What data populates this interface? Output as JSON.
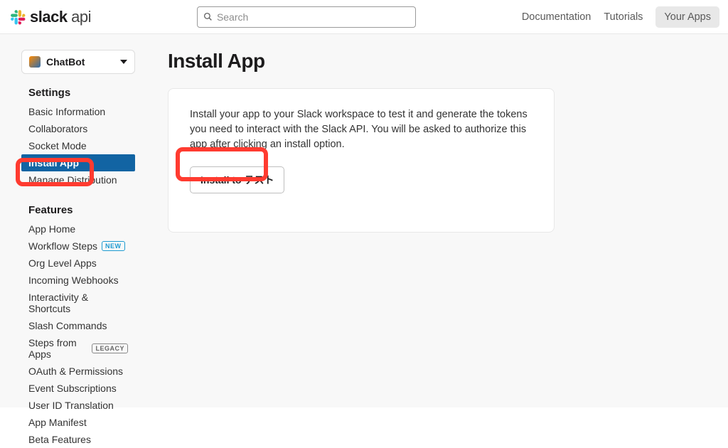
{
  "header": {
    "brand_bold": "slack",
    "brand_light": " api",
    "search_placeholder": "Search",
    "nav": {
      "documentation": "Documentation",
      "tutorials": "Tutorials",
      "your_apps": "Your Apps"
    }
  },
  "sidebar": {
    "app_name": "ChatBot",
    "settings_title": "Settings",
    "settings_items": [
      {
        "label": "Basic Information",
        "active": false
      },
      {
        "label": "Collaborators",
        "active": false
      },
      {
        "label": "Socket Mode",
        "active": false
      },
      {
        "label": "Install App",
        "active": true
      },
      {
        "label": "Manage Distribution",
        "active": false
      }
    ],
    "features_title": "Features",
    "features_items": [
      {
        "label": "App Home"
      },
      {
        "label": "Workflow Steps",
        "badge": "NEW"
      },
      {
        "label": "Org Level Apps"
      },
      {
        "label": "Incoming Webhooks"
      },
      {
        "label": "Interactivity & Shortcuts"
      },
      {
        "label": "Slash Commands"
      },
      {
        "label": "Steps from Apps",
        "badge": "LEGACY"
      },
      {
        "label": "OAuth & Permissions"
      },
      {
        "label": "Event Subscriptions"
      },
      {
        "label": "User ID Translation"
      },
      {
        "label": "App Manifest"
      },
      {
        "label": "Beta Features"
      }
    ]
  },
  "main": {
    "title": "Install App",
    "description": "Install your app to your Slack workspace to test it and generate the tokens you need to interact with the Slack API. You will be asked to authorize this app after clicking an install option.",
    "install_button": "Install to テスト"
  }
}
